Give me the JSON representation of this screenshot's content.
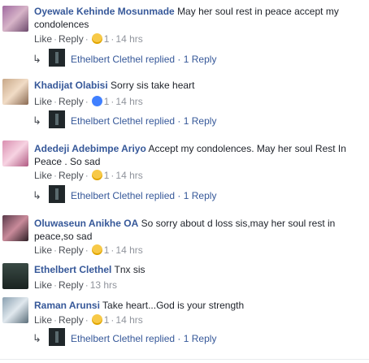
{
  "comments": [
    {
      "author": "Oyewale Kehinde Mosunmade",
      "text": "May her soul rest in peace accept my condolences",
      "like": "Like",
      "reply": "Reply",
      "reaction": "sad",
      "count": "1",
      "time": "14 hrs",
      "replied_by": "Ethelbert Clethel replied",
      "reply_count": "1 Reply"
    },
    {
      "author": "Khadijat Olabisi",
      "text": "Sorry sis take heart",
      "like": "Like",
      "reply": "Reply",
      "reaction": "like",
      "count": "1",
      "time": "14 hrs",
      "replied_by": "Ethelbert Clethel replied",
      "reply_count": "1 Reply"
    },
    {
      "author": "Adedeji Adebimpe Ariyo",
      "text": "Accept my condolences. May her soul Rest In Peace . So sad",
      "like": "Like",
      "reply": "Reply",
      "reaction": "sad",
      "count": "1",
      "time": "14 hrs",
      "replied_by": "Ethelbert Clethel replied",
      "reply_count": "1 Reply"
    },
    {
      "author": "Oluwaseun Anikhe OA",
      "text": "So sorry about d loss sis,may her soul rest in peace,so sad",
      "like": "Like",
      "reply": "Reply",
      "reaction": "sad",
      "count": "1",
      "time": "14 hrs"
    },
    {
      "author": "Ethelbert Clethel",
      "text": "Tnx sis",
      "like": "Like",
      "reply": "Reply",
      "time": "13 hrs"
    },
    {
      "author": "Raman Arunsi",
      "text": "Take heart...God is your strength",
      "like": "Like",
      "reply": "Reply",
      "reaction": "sad",
      "count": "1",
      "time": "14 hrs",
      "replied_by": "Ethelbert Clethel replied",
      "reply_count": "1 Reply"
    }
  ],
  "colors": {
    "link": "#365899",
    "meta": "#90949c",
    "text": "#1d2129"
  },
  "icons": {
    "reply_arrow": "reply-arrow-icon",
    "sad": "sad-reaction-icon",
    "like": "like-reaction-icon"
  }
}
